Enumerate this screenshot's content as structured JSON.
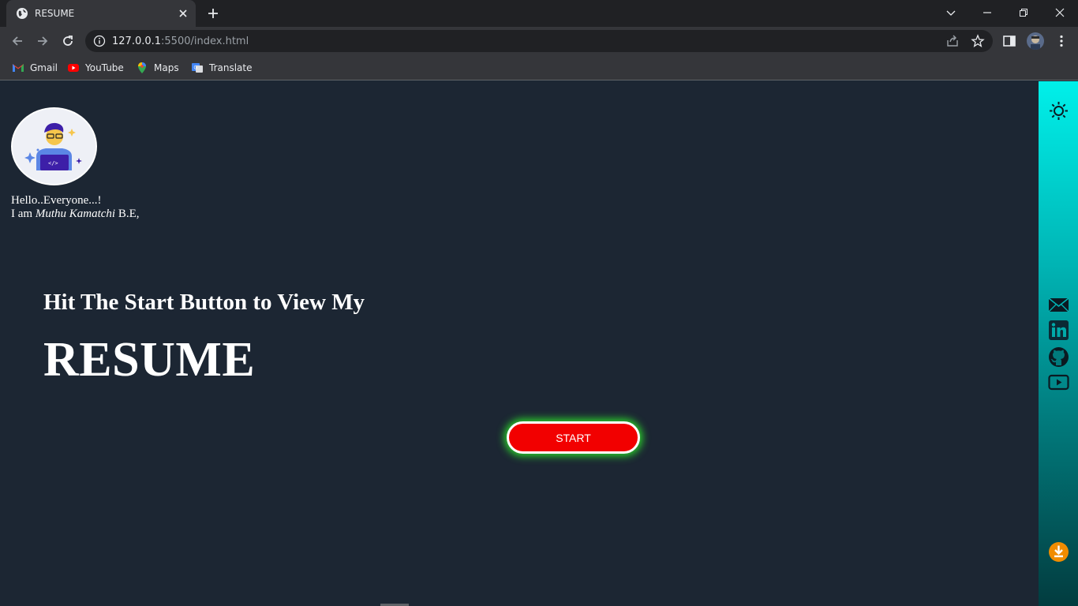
{
  "browser": {
    "tab_title": "RESUME",
    "url_host": "127.0.0.1",
    "url_rest": ":5500/index.html",
    "bookmarks": [
      {
        "label": "Gmail",
        "icon": "gmail-icon"
      },
      {
        "label": "YouTube",
        "icon": "youtube-icon"
      },
      {
        "label": "Maps",
        "icon": "maps-icon"
      },
      {
        "label": "Translate",
        "icon": "translate-icon"
      }
    ]
  },
  "page": {
    "greeting_line1": "Hello..Everyone...!",
    "greeting_prefix": "I am ",
    "greeting_name": "Muthu Kamatchi",
    "greeting_suffix": " B.E,",
    "sub_heading": "Hit The Start Button to View My",
    "big_heading": "RESUME",
    "start_label": "START"
  },
  "sidebar": {
    "icons": [
      "sun-icon",
      "mail-icon",
      "linkedin-icon",
      "github-icon",
      "youtube-icon",
      "download-icon"
    ]
  },
  "colors": {
    "page_bg": "#1c2633",
    "start_button": "#f20000",
    "start_glow": "#2bd62b",
    "sidebar_top": "#00f0ea",
    "sidebar_bottom": "#023c3f"
  }
}
